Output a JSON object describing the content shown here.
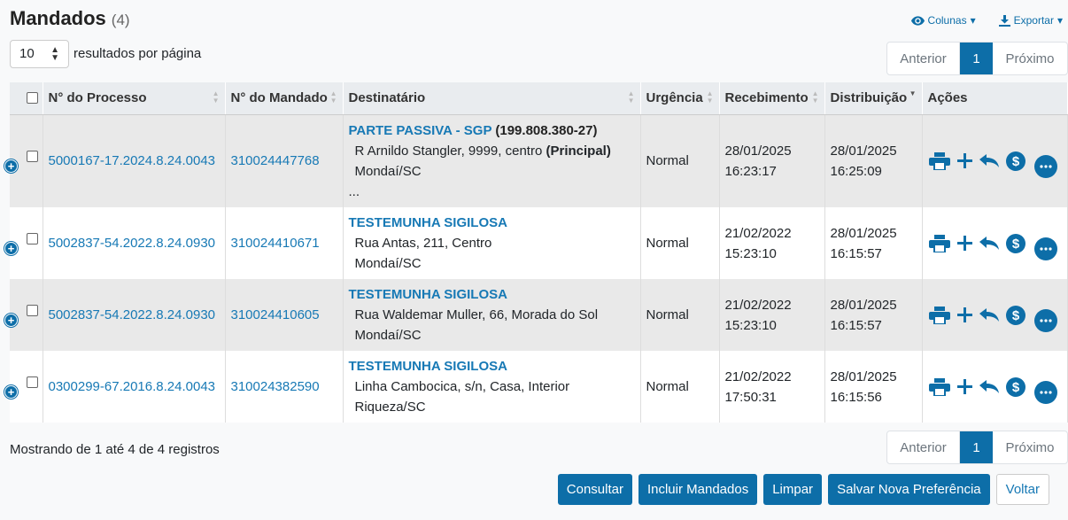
{
  "header": {
    "title": "Mandados",
    "count": "(4)",
    "columns_label": "Colunas",
    "export_label": "Exportar"
  },
  "page_size": {
    "value": "10",
    "label": "resultados por página"
  },
  "pagination": {
    "prev": "Anterior",
    "current": "1",
    "next": "Próximo"
  },
  "table": {
    "headers": [
      "N° do Processo",
      "N° do Mandado",
      "Destinatário",
      "Urgência",
      "Recebimento",
      "Distribuição",
      "Ações"
    ],
    "rows": [
      {
        "processo": "5000167-17.2024.8.24.0043",
        "mandado": "310024447768",
        "dest_name": "PARTE PASSIVA - SGP",
        "dest_extra": "(199.808.380-27)",
        "addr1": "R Arnildo Stangler, 9999, centro",
        "addr1_extra": "(Principal)",
        "addr2": "Mondaí/SC",
        "addr3": "...",
        "urgencia": "Normal",
        "receb_date": "28/01/2025",
        "receb_time": "16:23:17",
        "dist_date": "28/01/2025",
        "dist_time": "16:25:09"
      },
      {
        "processo": "5002837-54.2022.8.24.0930",
        "mandado": "310024410671",
        "dest_name": "TESTEMUNHA SIGILOSA",
        "addr1": "Rua Antas, 211, Centro",
        "addr2": "Mondaí/SC",
        "urgencia": "Normal",
        "receb_date": "21/02/2022",
        "receb_time": "15:23:10",
        "dist_date": "28/01/2025",
        "dist_time": "16:15:57"
      },
      {
        "processo": "5002837-54.2022.8.24.0930",
        "mandado": "310024410605",
        "dest_name": "TESTEMUNHA SIGILOSA",
        "addr1": "Rua Waldemar Muller, 66, Morada do Sol",
        "addr2": "Mondaí/SC",
        "urgencia": "Normal",
        "receb_date": "21/02/2022",
        "receb_time": "15:23:10",
        "dist_date": "28/01/2025",
        "dist_time": "16:15:57"
      },
      {
        "processo": "0300299-67.2016.8.24.0043",
        "mandado": "310024382590",
        "dest_name": "TESTEMUNHA SIGILOSA",
        "addr1": "Linha Cambocica, s/n, Casa, Interior",
        "addr2": "Riqueza/SC",
        "urgencia": "Normal",
        "receb_date": "21/02/2022",
        "receb_time": "17:50:31",
        "dist_date": "28/01/2025",
        "dist_time": "16:15:56"
      }
    ]
  },
  "footer": {
    "info": "Mostrando de 1 até 4 de 4 registros"
  },
  "buttons": {
    "consultar": "Consultar",
    "incluir": "Incluir Mandados",
    "limpar": "Limpar",
    "salvar": "Salvar Nova Preferência",
    "voltar": "Voltar"
  },
  "colors": {
    "accent": "#0d6ea8",
    "link": "#1779b5"
  }
}
